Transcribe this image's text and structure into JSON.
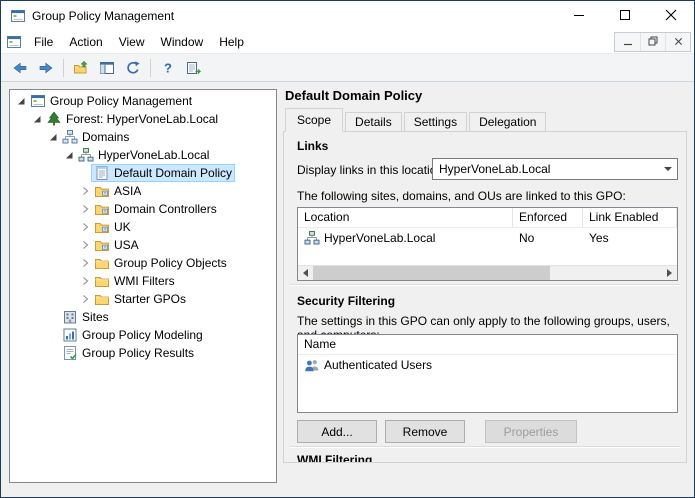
{
  "colors": {
    "selection_bg": "#cce8ff",
    "selection_border": "#99d1ff",
    "accent_blue": "#3b6ea5",
    "pane_border": "#828790",
    "window_bg": "#f0f0f0",
    "titlebar_bg": "#ffffff"
  },
  "window": {
    "title": "Group Policy Management",
    "controls": [
      "minimize",
      "maximize",
      "close"
    ]
  },
  "menu": {
    "items": [
      "File",
      "Action",
      "View",
      "Window",
      "Help"
    ],
    "mdi_controls": [
      "minimize",
      "restore",
      "close"
    ]
  },
  "toolbar": {
    "buttons": [
      {
        "icon": "back-icon"
      },
      {
        "icon": "forward-icon"
      },
      {
        "sep": true
      },
      {
        "icon": "up-one-level-icon"
      },
      {
        "icon": "show-console-tree-icon"
      },
      {
        "icon": "refresh-icon"
      },
      {
        "sep": true
      },
      {
        "icon": "help-icon"
      },
      {
        "icon": "export-list-icon"
      }
    ]
  },
  "tree": {
    "items": [
      {
        "label": "Group Policy Management",
        "level": 0,
        "icon": "console-icon",
        "expand": "open",
        "selected": false
      },
      {
        "label": "Forest: HyperVoneLab.Local",
        "level": 1,
        "icon": "forest-icon",
        "expand": "open",
        "selected": false
      },
      {
        "label": "Domains",
        "level": 2,
        "icon": "domains-icon",
        "expand": "open",
        "selected": false
      },
      {
        "label": "HyperVoneLab.Local",
        "level": 3,
        "icon": "domain-icon",
        "expand": "open",
        "selected": false
      },
      {
        "label": "Default Domain Policy",
        "level": 4,
        "icon": "gpo-icon",
        "expand": "none",
        "selected": true
      },
      {
        "label": "ASIA",
        "level": 4,
        "icon": "ou-icon",
        "expand": "closed",
        "selected": false
      },
      {
        "label": "Domain Controllers",
        "level": 4,
        "icon": "ou-icon",
        "expand": "closed",
        "selected": false
      },
      {
        "label": "UK",
        "level": 4,
        "icon": "ou-icon",
        "expand": "closed",
        "selected": false
      },
      {
        "label": "USA",
        "level": 4,
        "icon": "ou-icon",
        "expand": "closed",
        "selected": false
      },
      {
        "label": "Group Policy Objects",
        "level": 4,
        "icon": "folder-icon",
        "expand": "closed",
        "selected": false
      },
      {
        "label": "WMI Filters",
        "level": 4,
        "icon": "folder-icon",
        "expand": "closed",
        "selected": false
      },
      {
        "label": "Starter GPOs",
        "level": 4,
        "icon": "folder-icon",
        "expand": "closed",
        "selected": false
      },
      {
        "label": "Sites",
        "level": 2,
        "icon": "sites-icon",
        "expand": "none",
        "selected": false
      },
      {
        "label": "Group Policy Modeling",
        "level": 2,
        "icon": "modeling-icon",
        "expand": "none",
        "selected": false
      },
      {
        "label": "Group Policy Results",
        "level": 2,
        "icon": "results-icon",
        "expand": "none",
        "selected": false
      }
    ]
  },
  "content": {
    "title": "Default Domain Policy",
    "tabs": [
      {
        "label": "Scope",
        "active": true
      },
      {
        "label": "Details",
        "active": false
      },
      {
        "label": "Settings",
        "active": false
      },
      {
        "label": "Delegation",
        "active": false
      }
    ],
    "links": {
      "heading": "Links",
      "display_label": "Display links in this location:",
      "display_value": "HyperVoneLab.Local",
      "description": "The following sites, domains, and OUs are linked to this GPO:",
      "table": {
        "columns": [
          "Location",
          "Enforced",
          "Link Enabled"
        ],
        "rows": [
          {
            "icon": "domain-icon",
            "location": "HyperVoneLab.Local",
            "enforced": "No",
            "link_enabled": "Yes"
          }
        ]
      }
    },
    "security": {
      "heading": "Security Filtering",
      "description": "The settings in this GPO can only apply to the following groups, users, and computers:",
      "table": {
        "columns": [
          "Name"
        ],
        "rows": [
          {
            "icon": "users-icon",
            "name": "Authenticated Users"
          }
        ]
      },
      "buttons": [
        {
          "label": "Add...",
          "enabled": true
        },
        {
          "label": "Remove",
          "enabled": true
        },
        {
          "label": "Properties",
          "enabled": false
        }
      ]
    },
    "wmi": {
      "heading": "WMI Filtering"
    }
  }
}
